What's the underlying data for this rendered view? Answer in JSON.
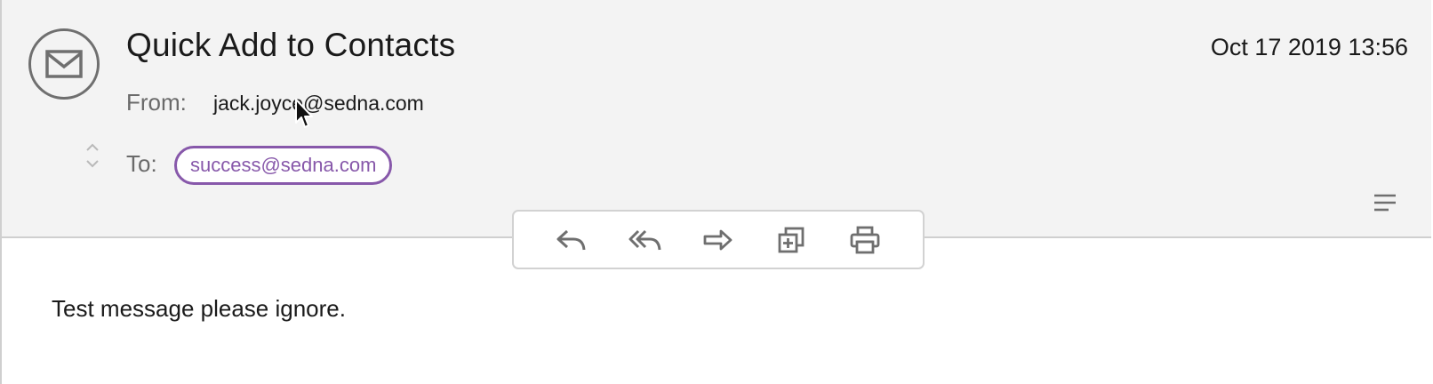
{
  "message": {
    "subject": "Quick Add to Contacts",
    "date": "Oct 17 2019 13:56",
    "from_label": "From:",
    "from_address": "jack.joyce@sedna.com",
    "to_label": "To:",
    "recipients": [
      "success@sedna.com"
    ],
    "body": "Test message please ignore."
  },
  "icons": {
    "avatar": "envelope-icon",
    "expand": "expand-collapse-icon",
    "menu": "hamburger-menu-icon",
    "toolbar": [
      "reply-icon",
      "reply-all-icon",
      "forward-icon",
      "add-to-collection-icon",
      "print-icon"
    ]
  },
  "colors": {
    "accent": "#8758aa",
    "header_bg": "#f3f3f3",
    "icon_gray": "#6f6f6f"
  }
}
